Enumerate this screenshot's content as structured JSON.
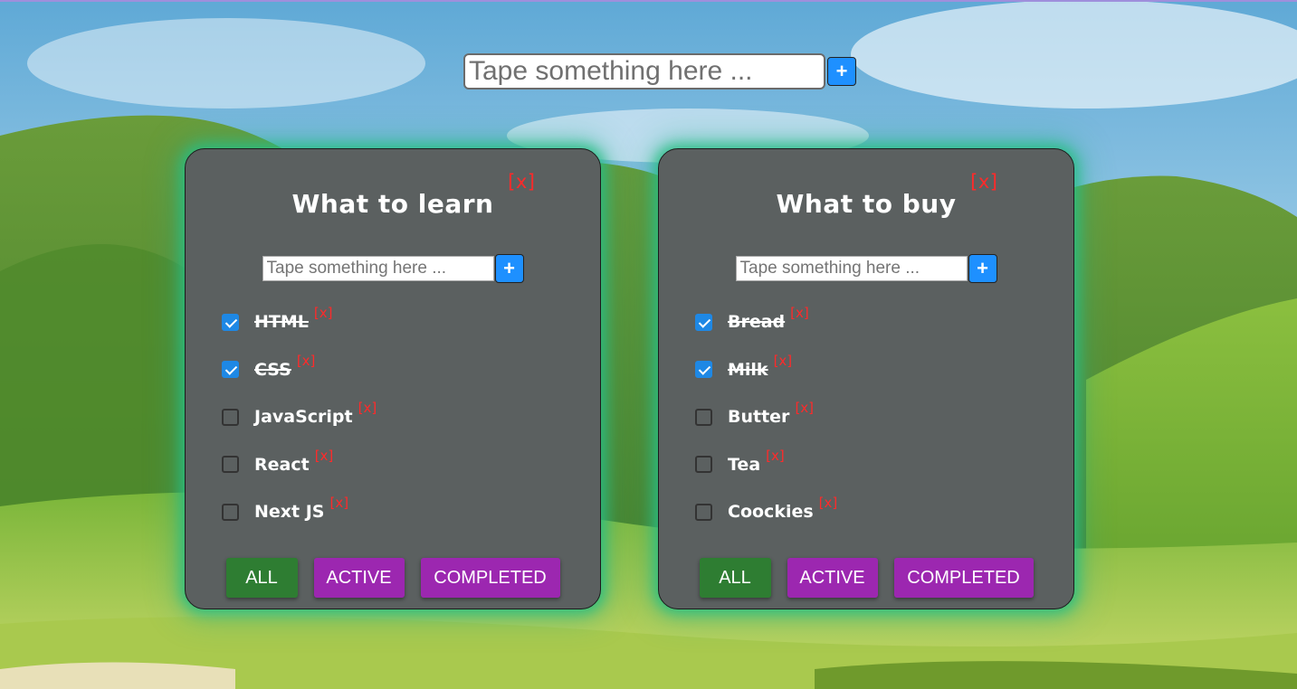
{
  "header": {
    "new_list_placeholder": "Tape something here ...",
    "add_label": "+"
  },
  "lists": [
    {
      "title": "What to learn",
      "delete_label": "[x]",
      "input_placeholder": "Tape something here ...",
      "add_label": "+",
      "tasks": [
        {
          "label": "HTML",
          "done": true,
          "delete_label": "[x]"
        },
        {
          "label": "CSS",
          "done": true,
          "delete_label": "[x]"
        },
        {
          "label": "JavaScript",
          "done": false,
          "delete_label": "[x]"
        },
        {
          "label": "React",
          "done": false,
          "delete_label": "[x]"
        },
        {
          "label": "Next JS",
          "done": false,
          "delete_label": "[x]"
        }
      ],
      "filters": {
        "all": "ALL",
        "active": "ACTIVE",
        "completed": "COMPLETED",
        "selected": "ALL"
      }
    },
    {
      "title": "What to buy",
      "delete_label": "[x]",
      "input_placeholder": "Tape something here ...",
      "add_label": "+",
      "tasks": [
        {
          "label": "Bread",
          "done": true,
          "delete_label": "[x]"
        },
        {
          "label": "Milk",
          "done": true,
          "delete_label": "[x]"
        },
        {
          "label": "Butter",
          "done": false,
          "delete_label": "[x]"
        },
        {
          "label": "Tea",
          "done": false,
          "delete_label": "[x]"
        },
        {
          "label": "Coockies",
          "done": false,
          "delete_label": "[x]"
        }
      ],
      "filters": {
        "all": "ALL",
        "active": "ACTIVE",
        "completed": "COMPLETED",
        "selected": "ALL"
      }
    }
  ],
  "colors": {
    "card_bg": "#5b6060",
    "card_glow": "#28be82",
    "delete_red": "#ff2a2a",
    "plus_blue": "#1e90ff",
    "checkbox_blue": "#1e88e5",
    "filter_all_green": "#2e7d32",
    "filter_purple": "#9c27b0"
  },
  "background": {
    "scene": "green-hills-landscape"
  }
}
